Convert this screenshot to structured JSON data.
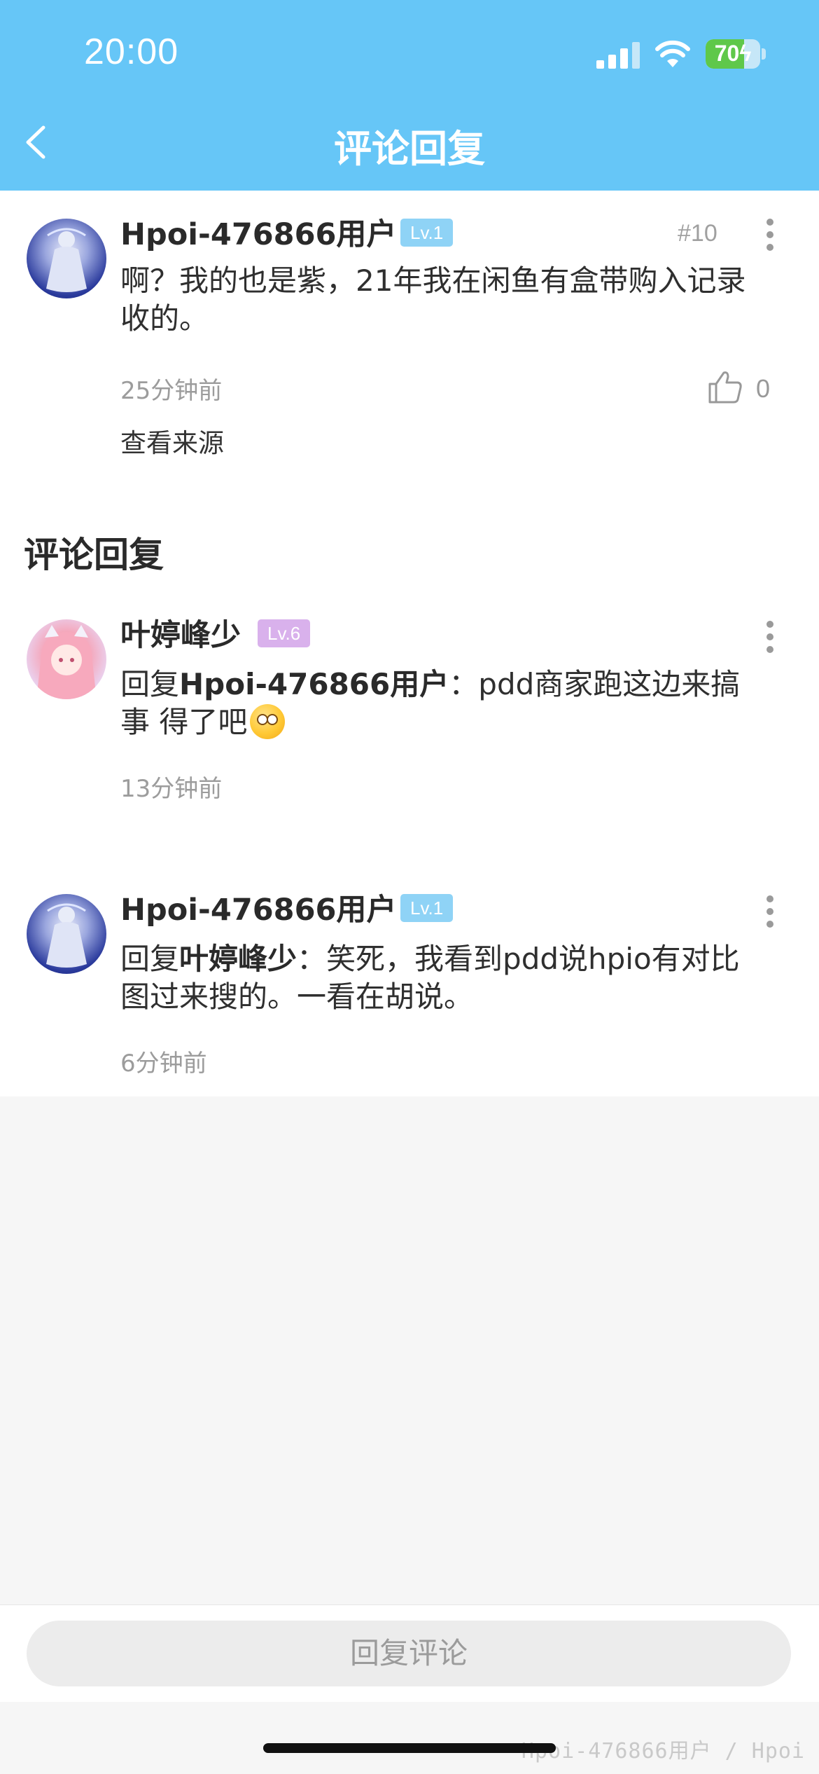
{
  "status_bar": {
    "time": "20:00",
    "battery": "70",
    "battery_fraction": 0.7
  },
  "header": {
    "title": "评论回复"
  },
  "main_comment": {
    "username": "Hpoi-476866用户",
    "level": "Lv.1",
    "floor": "#10",
    "text": "啊？我的也是紫，21年我在闲鱼有盒带购入记录收的。",
    "time": "25分钟前",
    "likes": "0",
    "view_source": "查看来源"
  },
  "section": {
    "title": "评论回复"
  },
  "replies": [
    {
      "username": "叶婷峰少",
      "level": "Lv.6",
      "reply_prefix": "回复",
      "reply_to": "Hpoi-476866用户",
      "separator": "：",
      "text": "pdd商家跑这边来搞事 得了吧",
      "emoji": "eye-roll-emoji",
      "time": "13分钟前"
    },
    {
      "username": "Hpoi-476866用户",
      "level": "Lv.1",
      "reply_prefix": "回复",
      "reply_to": "叶婷峰少",
      "separator": "：",
      "text": "笑死，我看到pdd说hpio有对比图过来搜的。一看在胡说。",
      "time": "6分钟前"
    }
  ],
  "bottom": {
    "reply_placeholder": "回复评论"
  },
  "watermark": "Hpoi-476866用户 / Hpoi",
  "colors": {
    "header_bg": "#66c6f7",
    "lv1_badge": "#8fd3f6",
    "lv6_badge": "#d9b1ec",
    "battery_green": "#5fc84a"
  }
}
